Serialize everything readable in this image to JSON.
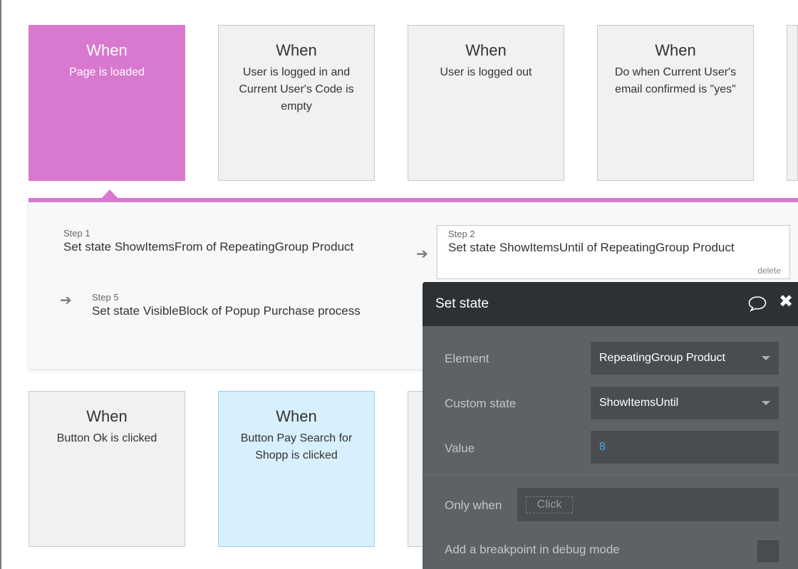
{
  "events_top": [
    {
      "when": "When",
      "condition": "Page is loaded"
    },
    {
      "when": "When",
      "condition": "User is logged in and Current User's Code is empty"
    },
    {
      "when": "When",
      "condition": "User is logged out"
    },
    {
      "when": "When",
      "condition": "Do when Current User's email confirmed is \"yes\""
    }
  ],
  "events_bottom": [
    {
      "when": "When",
      "condition": "Button Ok is clicked"
    },
    {
      "when": "When",
      "condition": "Button Pay Search for Shopp is clicked"
    }
  ],
  "steps": [
    {
      "label": "Step 1",
      "text": "Set state ShowItemsFrom of RepeatingGroup Product"
    },
    {
      "label": "Step 2",
      "text": "Set state ShowItemsUntil of RepeatingGroup Product",
      "delete": "delete"
    },
    {
      "label": "Step 5",
      "text": "Set state VisibleBlock of Popup Purchase process"
    }
  ],
  "property_editor": {
    "title": "Set state",
    "element_label": "Element",
    "element_value": "RepeatingGroup Product",
    "custom_state_label": "Custom state",
    "custom_state_value": "ShowItemsUntil",
    "value_label": "Value",
    "value": "8",
    "only_when_label": "Only when",
    "only_when_placeholder": "Click",
    "breakpoint_label": "Add a breakpoint in debug mode"
  },
  "colors": {
    "active_event": "#d978cf",
    "selected_event": "#d8effd",
    "panel_dark": "#2e3133",
    "panel_body": "#5f6264",
    "value_blue": "#4aa6ee"
  },
  "icons": [
    "arrow-right-icon",
    "comment-icon",
    "close-icon",
    "chevron-down-icon"
  ]
}
